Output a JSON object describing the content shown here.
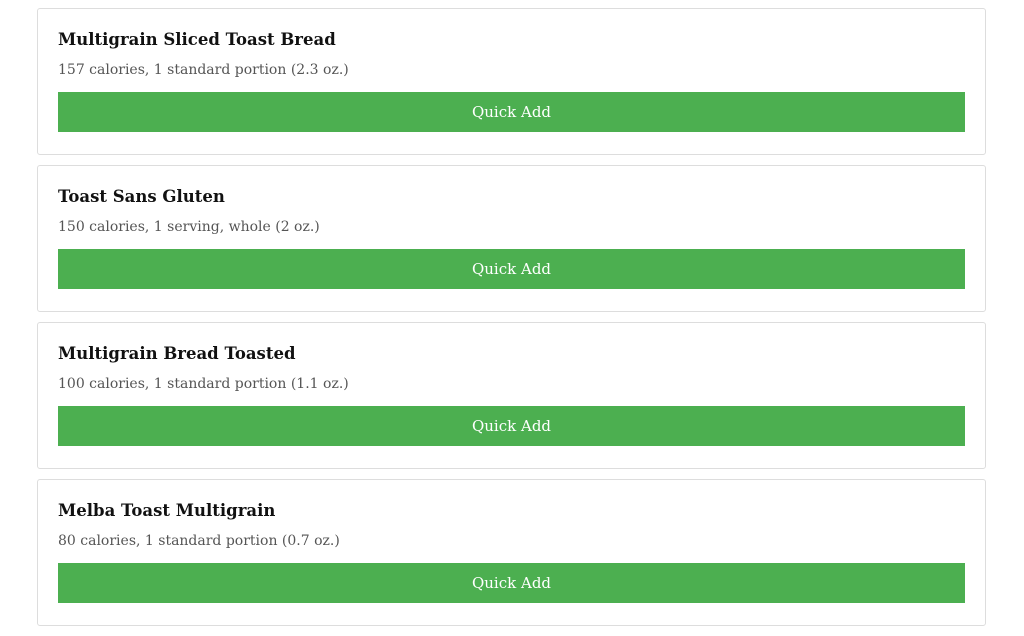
{
  "foods": [
    {
      "name": "Multigrain Sliced Toast Bread",
      "description": "157 calories, 1 standard portion (2.3 oz.)",
      "button_label": "Quick Add"
    },
    {
      "name": "Toast Sans Gluten",
      "description": "150 calories, 1 serving, whole (2 oz.)",
      "button_label": "Quick Add"
    },
    {
      "name": "Multigrain Bread Toasted",
      "description": "100 calories, 1 standard portion (1.1 oz.)",
      "button_label": "Quick Add"
    },
    {
      "name": "Melba Toast Multigrain",
      "description": "80 calories, 1 standard portion (0.7 oz.)",
      "button_label": "Quick Add"
    }
  ],
  "colors": {
    "button_bg": "#4caf50",
    "button_text": "#ffffff",
    "card_border": "#dddddd"
  }
}
